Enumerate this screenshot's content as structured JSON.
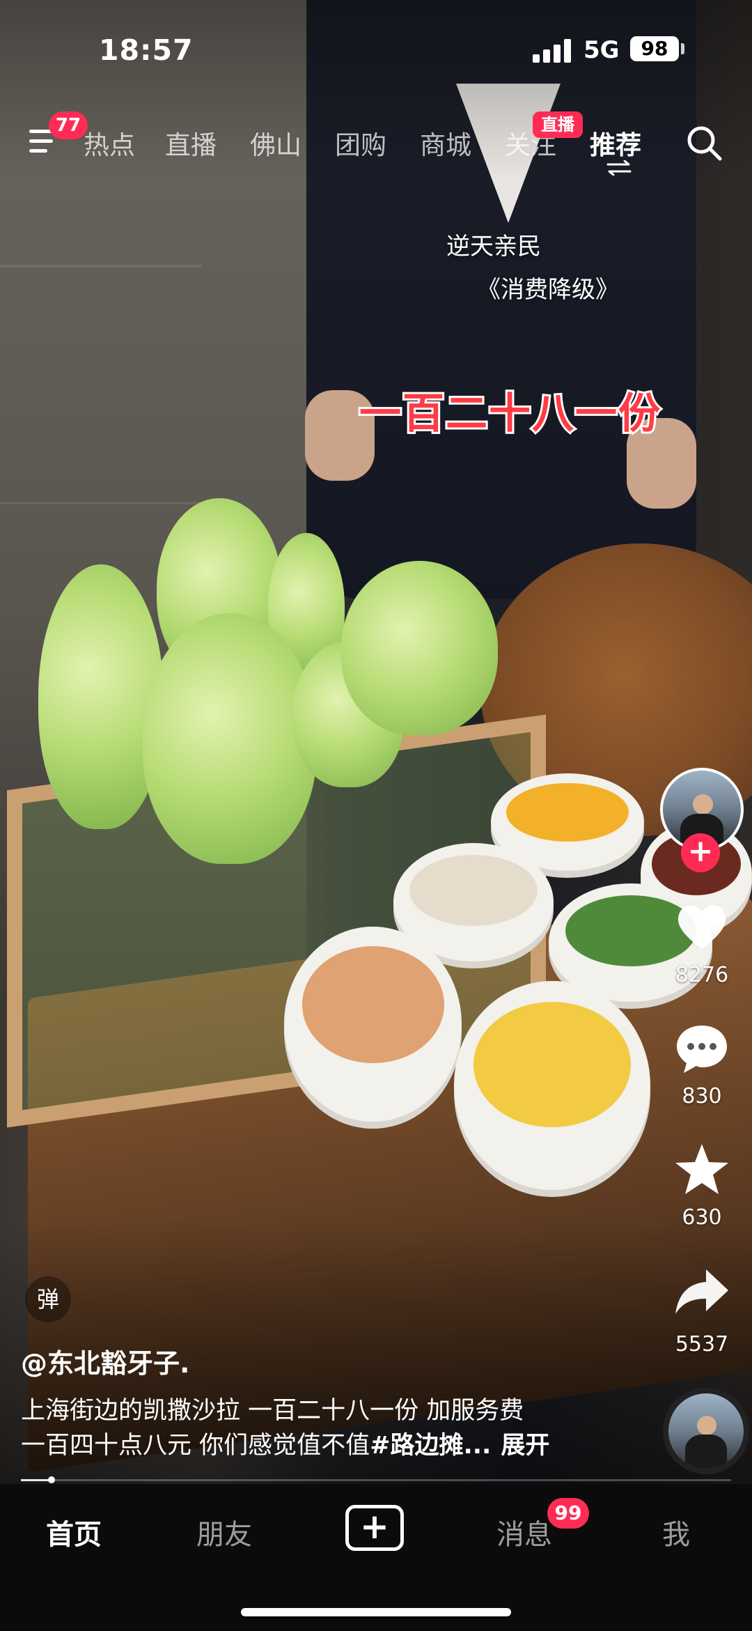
{
  "status_bar": {
    "time": "18:57",
    "network": "5G",
    "battery": "98"
  },
  "top_nav": {
    "menu_badge": "77",
    "tabs": [
      {
        "label": "热点",
        "active": false
      },
      {
        "label": "直播",
        "active": false
      },
      {
        "label": "佛山",
        "active": false
      },
      {
        "label": "团购",
        "active": false
      },
      {
        "label": "商城",
        "active": false
      },
      {
        "label": "关注",
        "active": false
      },
      {
        "label": "推荐",
        "active": true
      }
    ],
    "follow_live_badge": "直播"
  },
  "video": {
    "caption_line1": "逆天亲民",
    "caption_line2": "《消费降级》",
    "overlay_title": "一百二十八一份"
  },
  "actions": {
    "likes": "8276",
    "comments": "830",
    "favorites": "630",
    "shares": "5537",
    "follow_symbol": "+"
  },
  "post": {
    "danmu_label": "弹",
    "author": "@东北豁牙子.",
    "description_line1": "上海街边的凯撒沙拉 一百二十八一份 加服务费",
    "description_line2": "一百四十点八元 你们感觉值不值",
    "hashtag": "#路边摊...",
    "expand_label": "展开",
    "progress_fraction": 0.043
  },
  "bottom_tabs": {
    "home": "首页",
    "friends": "朋友",
    "create": "+",
    "messages": "消息",
    "messages_badge": "99",
    "me": "我"
  },
  "colors": {
    "accent": "#fe2c55",
    "tabbar": "#0b0b0b",
    "overlay_title": "#ff3b45"
  }
}
